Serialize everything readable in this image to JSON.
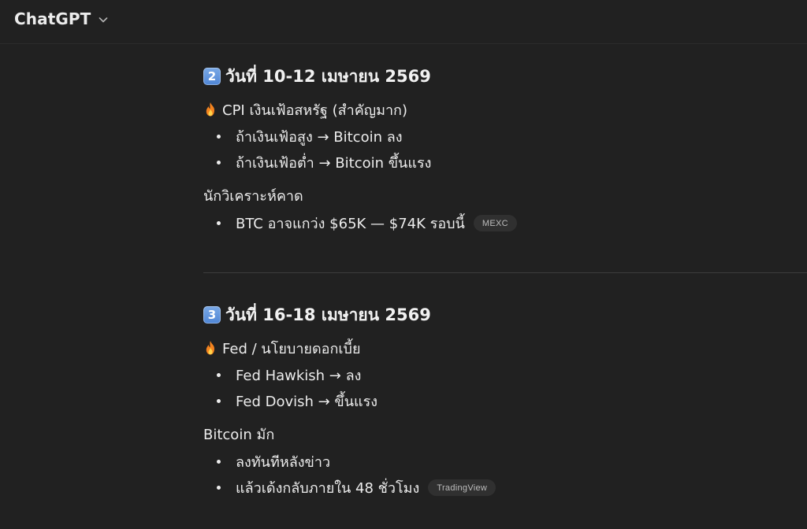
{
  "header": {
    "title": "ChatGPT"
  },
  "sections": [
    {
      "number": "2",
      "title": "วันที่ 10-12 เมษายน 2569",
      "lead": "CPI เงินเฟ้อสหรัฐ (สำคัญมาก)",
      "lead_bullets": [
        "ถ้าเงินเฟ้อสูง → Bitcoin ลง",
        "ถ้าเงินเฟ้อต่ำ → Bitcoin ขึ้นแรง"
      ],
      "subhead": "นักวิเคราะห์คาด",
      "sub_bullets": [
        "BTC อาจแกว่ง $65K — $74K รอบนี้"
      ],
      "source": "MEXC"
    },
    {
      "number": "3",
      "title": "วันที่ 16-18 เมษายน 2569",
      "lead": "Fed / นโยบายดอกเบี้ย",
      "lead_bullets": [
        "Fed Hawkish → ลง",
        "Fed Dovish → ขึ้นแรง"
      ],
      "subhead": "Bitcoin มัก",
      "sub_bullets": [
        "ลงทันทีหลังข่าว",
        "แล้วเด้งกลับภายใน 48 ชั่วโมง"
      ],
      "source": "TradingView"
    }
  ],
  "icons": {
    "header_chevron": "chevron-down-icon",
    "lead_marker": "fire-icon",
    "section_number": "keycap-number-icon"
  },
  "colors": {
    "background": "#212121",
    "text": "#ececec",
    "pill_bg": "#303030",
    "keycap": "#5b8fd9",
    "fire": "#f4831f"
  }
}
